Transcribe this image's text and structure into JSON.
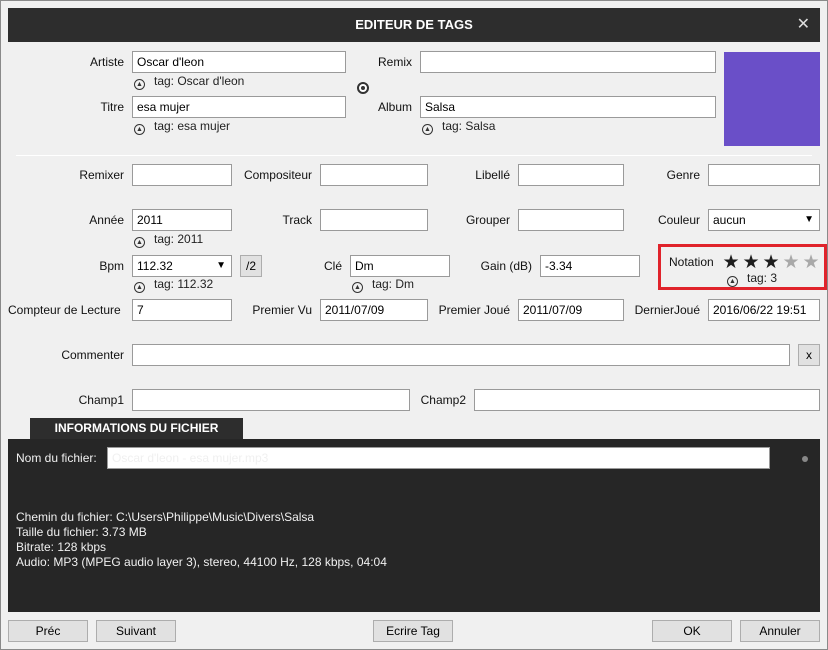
{
  "window": {
    "title": "EDITEUR DE TAGS",
    "close_label": "✕"
  },
  "top": {
    "artist_label": "Artiste",
    "artist_value": "Oscar d'leon",
    "artist_tag": "tag: Oscar d'leon",
    "title_label": "Titre",
    "title_value": "esa mujer",
    "title_tag": "tag: esa mujer",
    "remix_label": "Remix",
    "remix_value": "",
    "album_label": "Album",
    "album_value": "Salsa",
    "album_tag": "tag: Salsa",
    "cover_color": "#6a4fc8"
  },
  "row1": {
    "remixer_label": "Remixer",
    "remixer_value": "",
    "composer_label": "Compositeur",
    "composer_value": "",
    "label_label": "Libellé",
    "label_value": "",
    "genre_label": "Genre",
    "genre_value": ""
  },
  "row2": {
    "year_label": "Année",
    "year_value": "2011",
    "year_tag": "tag: 2011",
    "track_label": "Track",
    "track_value": "",
    "group_label": "Grouper",
    "group_value": "",
    "color_label": "Couleur",
    "color_value": "aucun"
  },
  "row3": {
    "bpm_label": "Bpm",
    "bpm_value": "112.32",
    "bpm_tag": "tag: 112.32",
    "half_button": "/2",
    "key_label": "Clé",
    "key_value": "Dm",
    "key_tag": "tag: Dm",
    "gain_label": "Gain (dB)",
    "gain_value": "-3.34",
    "rating_label": "Notation",
    "rating_value": 3,
    "rating_max": 5,
    "rating_tag": "tag: 3",
    "highlight_color": "#e0232b"
  },
  "row4": {
    "playcount_label": "Compteur de Lecture",
    "playcount_value": "7",
    "firstseen_label": "Premier Vu",
    "firstseen_value": "2011/07/09",
    "firstplayed_label": "Premier Joué",
    "firstplayed_value": "2011/07/09",
    "lastplayed_label": "DernierJoué",
    "lastplayed_value": "2016/06/22 19:51"
  },
  "comment": {
    "label": "Commenter",
    "value": "",
    "clear_button": "x"
  },
  "fields": {
    "field1_label": "Champ1",
    "field1_value": "",
    "field2_label": "Champ2",
    "field2_value": ""
  },
  "fileinfo": {
    "tab_label": "INFORMATIONS DU FICHIER",
    "filename_label": "Nom du fichier:",
    "filename_value": "Oscar d'leon - esa mujer.mp3",
    "path": "Chemin du fichier: C:\\Users\\Philippe\\Music\\Divers\\Salsa",
    "size": "Taille du fichier: 3.73 MB",
    "bitrate": "Bitrate: 128 kbps",
    "audio": "Audio: MP3 (MPEG audio layer 3), stereo, 44100 Hz, 128 kbps, 04:04"
  },
  "buttons": {
    "prev": "Préc",
    "next": "Suivant",
    "write_tag": "Ecrire Tag",
    "ok": "OK",
    "cancel": "Annuler"
  },
  "icons": {
    "tag_icon": "up-arrow-circle-icon",
    "star_filled": "★",
    "star_empty": "★"
  }
}
